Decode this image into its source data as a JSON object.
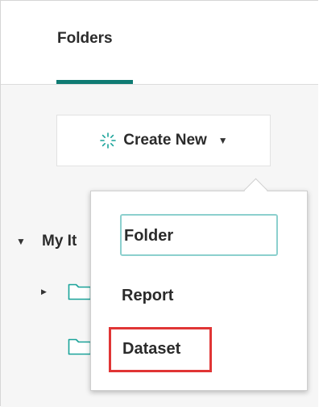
{
  "header": {
    "tab_label": "Folders"
  },
  "toolbar": {
    "create_new_label": "Create New"
  },
  "tree": {
    "root_label": "My It"
  },
  "menu": {
    "items": [
      {
        "label": "Folder"
      },
      {
        "label": "Report"
      },
      {
        "label": "Dataset"
      }
    ]
  },
  "icons": [
    "sparkle-icon",
    "caret-down-icon",
    "caret-right-icon",
    "folder-icon"
  ],
  "colors": {
    "accent": "#0f7b73",
    "focus": "#8cd0ce",
    "highlight": "#e03535"
  }
}
